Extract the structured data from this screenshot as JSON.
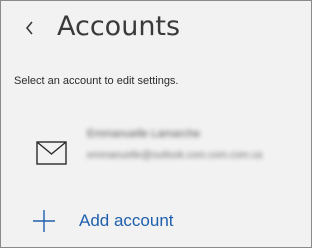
{
  "header": {
    "title": "Accounts",
    "back_icon": "chevron-left-icon"
  },
  "instructions": "Select an account to edit settings.",
  "accounts": [
    {
      "icon": "mail-icon",
      "name": "Emmanuelle Lamarche",
      "email": "emmanuelle@outlook.com.com.com.ca",
      "obscured": true
    }
  ],
  "add_account": {
    "label": "Add account",
    "icon": "plus-icon"
  },
  "colors": {
    "background": "#f2f2f2",
    "border": "#8a8a8a",
    "title_text": "#3a3a3a",
    "body_text": "#2b2b2b",
    "accent": "#1e5fae",
    "icon_stroke": "#2b2b2b"
  }
}
